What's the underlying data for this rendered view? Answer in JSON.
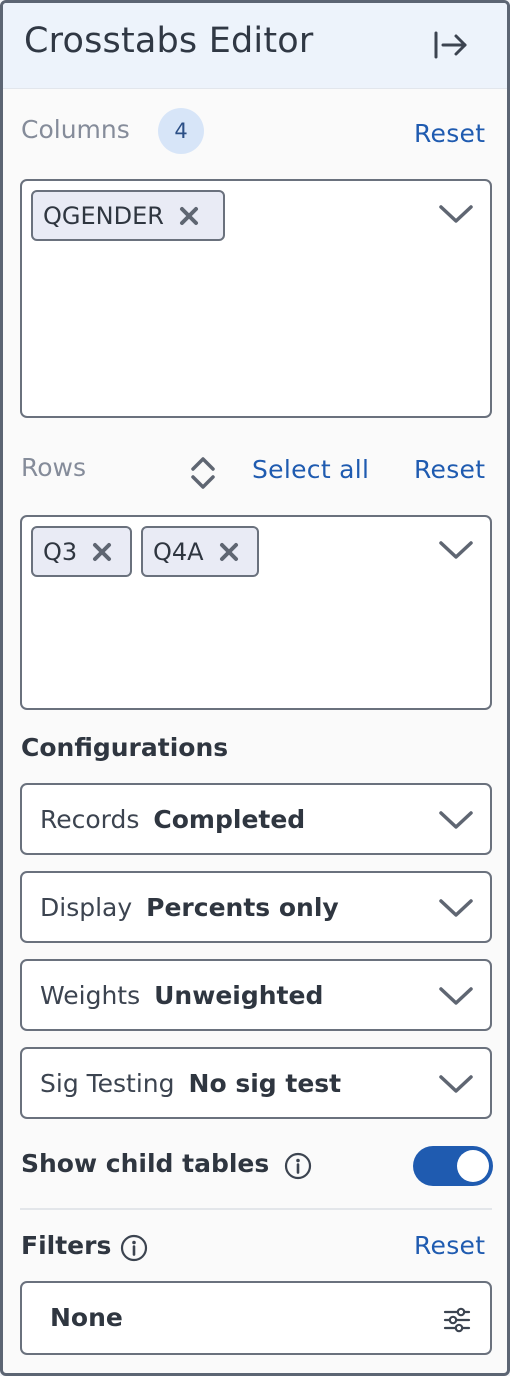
{
  "header": {
    "title": "Crosstabs Editor",
    "collapse_icon": "collapse-right-icon"
  },
  "columns": {
    "label": "Columns",
    "count": "4",
    "reset_label": "Reset",
    "chips": [
      "QGENDER"
    ]
  },
  "rows": {
    "label": "Rows",
    "select_all_label": "Select all",
    "reset_label": "Reset",
    "chips": [
      "Q3",
      "Q4A"
    ]
  },
  "configurations": {
    "heading": "Configurations",
    "items": [
      {
        "label": "Records",
        "value": "Completed"
      },
      {
        "label": "Display",
        "value": "Percents only"
      },
      {
        "label": "Weights",
        "value": "Unweighted"
      },
      {
        "label": "Sig Testing",
        "value": "No sig test"
      }
    ]
  },
  "child_tables": {
    "label": "Show child tables",
    "enabled": true
  },
  "filters": {
    "label": "Filters",
    "reset_label": "Reset",
    "value": "None"
  },
  "colors": {
    "accent": "#1f5bb0",
    "header_bg": "#edf3fb",
    "badge_bg": "#d7e5f8",
    "chip_bg": "#e9ebf5"
  }
}
